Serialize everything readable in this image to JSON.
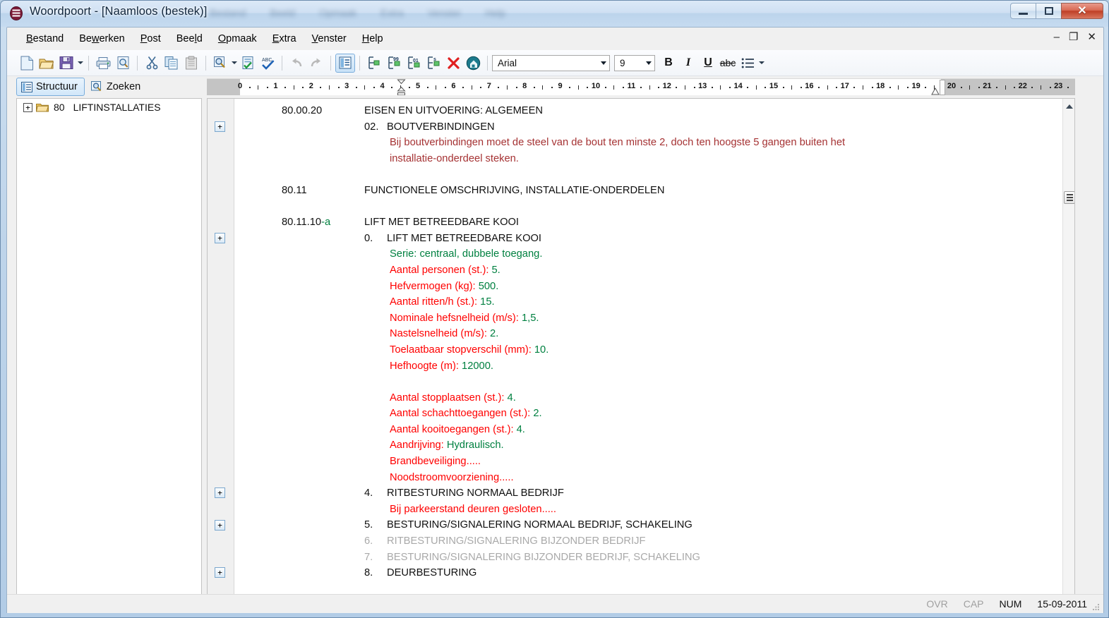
{
  "window": {
    "title": "Woordpoort - [Naamloos (bestek)]",
    "app_icon": "app-icon",
    "ghost_menu_items": [
      "Bestand",
      "Beeld",
      "Opmaak",
      "Extra",
      "Venster",
      "Help"
    ],
    "controls": {
      "minimize": "–",
      "restore": "□",
      "close": "✕"
    }
  },
  "menu": {
    "items": [
      {
        "label": "Bestand",
        "accel": "B"
      },
      {
        "label": "Bewerken",
        "accel": "w"
      },
      {
        "label": "Post",
        "accel": "P"
      },
      {
        "label": "Beeld",
        "accel": "l"
      },
      {
        "label": "Opmaak",
        "accel": "O"
      },
      {
        "label": "Extra",
        "accel": "E"
      },
      {
        "label": "Venster",
        "accel": "V"
      },
      {
        "label": "Help",
        "accel": "H"
      }
    ]
  },
  "mdi_controls": {
    "minimize": "–",
    "restore": "❐",
    "close": "✕"
  },
  "toolbar": {
    "buttons": [
      "new-document-icon",
      "open-folder-icon",
      "save-icon",
      "save-dropdown-arrow",
      "print-icon",
      "print-preview-icon",
      "cut-icon",
      "copy-icon",
      "paste-icon",
      "find-icon",
      "find-dropdown-arrow",
      "spellcheck-list-icon",
      "spelling-icon",
      "undo-icon",
      "redo-icon",
      "outline-view-icon",
      "insert-item-icon",
      "insert-numbered-item-icon",
      "insert-dot-item-icon",
      "insert-s-item-icon",
      "delete-icon",
      "export-icon"
    ],
    "font_name": "Arial",
    "font_size": "9",
    "bold_label": "B",
    "italic_label": "I",
    "underline_label": "U",
    "strike_label": "abc",
    "list_label": "list-icon",
    "list_dropdown_arrow": "chevron-down-icon"
  },
  "tabs": [
    {
      "label": "Structuur",
      "icon": "structure-icon",
      "selected": true
    },
    {
      "label": "Zoeken",
      "icon": "search-icon",
      "selected": false
    }
  ],
  "ruler": {
    "numbers": [
      0,
      1,
      2,
      3,
      4,
      5,
      6,
      7,
      8,
      9,
      10,
      11,
      12,
      13,
      14,
      15,
      16,
      17,
      18,
      19,
      20,
      21,
      22,
      23
    ],
    "left_margin_end": 0,
    "right_margin_start": 20,
    "first_line_indent": 4.5,
    "right_indent": 19.6,
    "unit": "cm"
  },
  "tree": {
    "rows": [
      {
        "expander": "+",
        "icon": "folder-icon",
        "code": "80",
        "label": "LIFTINSTALLATIES"
      }
    ]
  },
  "document": {
    "lines": [
      {
        "code": "80.00.20",
        "title": "EISEN EN UITVOERING: ALGEMEEN",
        "style": "black",
        "kind": "code-title"
      },
      {
        "num": "02.",
        "title": "BOUTVERBINDINGEN",
        "style": "black",
        "kind": "num-title",
        "plus": true
      },
      {
        "body": "Bij boutverbindingen moet de steel van de bout ten minste 2, doch ten hoogste 5 gangen buiten het",
        "style": "darkred",
        "kind": "body"
      },
      {
        "body": "installatie-onderdeel steken.",
        "style": "darkred",
        "kind": "body"
      },
      {
        "kind": "blank"
      },
      {
        "code": "80.11",
        "title": "FUNCTIONELE OMSCHRIJVING, INSTALLATIE-ONDERDELEN",
        "style": "black",
        "kind": "code-title"
      },
      {
        "kind": "blank"
      },
      {
        "code": "80.11.10",
        "code_suffix": "-a",
        "title": "LIFT MET BETREEDBARE KOOI",
        "style": "black",
        "kind": "code-title"
      },
      {
        "num": "0.",
        "title": "LIFT MET BETREEDBARE KOOI",
        "style": "black",
        "kind": "num-title",
        "plus": true
      },
      {
        "label": "Serie:",
        "value": " centraal, dubbele toegang.",
        "label_style": "green",
        "value_style": "green",
        "kind": "kv"
      },
      {
        "label": "Aantal personen (st.):",
        "value": " 5.",
        "label_style": "red",
        "value_style": "green",
        "kind": "kv"
      },
      {
        "label": "Hefvermogen (kg):",
        "value": " 500.",
        "label_style": "red",
        "value_style": "green",
        "kind": "kv"
      },
      {
        "label": "Aantal ritten/h (st.):",
        "value": " 15.",
        "label_style": "red",
        "value_style": "green",
        "kind": "kv"
      },
      {
        "label": "Nominale hefsnelheid (m/s):",
        "value": " 1,5.",
        "label_style": "red",
        "value_style": "green",
        "kind": "kv"
      },
      {
        "label": "Nastelsnelheid (m/s):",
        "value": " 2.",
        "label_style": "red",
        "value_style": "green",
        "kind": "kv"
      },
      {
        "label": "Toelaatbaar stopverschil (mm):",
        "value": " 10.",
        "label_style": "red",
        "value_style": "green",
        "kind": "kv"
      },
      {
        "label": "Hefhoogte (m):",
        "value": " 12000.",
        "label_style": "red",
        "value_style": "green",
        "kind": "kv"
      },
      {
        "kind": "blank"
      },
      {
        "label": "Aantal stopplaatsen (st.):",
        "value": " 4.",
        "label_style": "red",
        "value_style": "green",
        "kind": "kv"
      },
      {
        "label": "Aantal schachttoegangen (st.):",
        "value": " 2.",
        "label_style": "red",
        "value_style": "green",
        "kind": "kv"
      },
      {
        "label": "Aantal kooitoegangen (st.):",
        "value": " 4.",
        "label_style": "red",
        "value_style": "green",
        "kind": "kv"
      },
      {
        "label": "Aandrijving:",
        "value": " Hydraulisch.",
        "label_style": "red",
        "value_style": "green",
        "kind": "kv"
      },
      {
        "label": "Brandbeveiliging",
        "value": ".....",
        "label_style": "red",
        "value_style": "red",
        "kind": "kv"
      },
      {
        "label": "Noodstroomvoorziening",
        "value": ".....",
        "label_style": "red",
        "value_style": "red",
        "kind": "kv"
      },
      {
        "num": "4.",
        "title": "RITBESTURING NORMAAL BEDRIJF",
        "style": "black",
        "kind": "num-title",
        "plus": true
      },
      {
        "label": "Bij parkeerstand deuren gesloten",
        "value": ".....",
        "label_style": "red",
        "value_style": "red",
        "kind": "kv"
      },
      {
        "num": "5.",
        "title": "BESTURING/SIGNALERING NORMAAL BEDRIJF, SCHAKELING",
        "style": "black",
        "kind": "num-title",
        "plus": true
      },
      {
        "num": "6.",
        "title": "RITBESTURING/SIGNALERING BIJZONDER BEDRIJF",
        "style": "gray",
        "kind": "num-title"
      },
      {
        "num": "7.",
        "title": "BESTURING/SIGNALERING BIJZONDER BEDRIJF, SCHAKELING",
        "style": "gray",
        "kind": "num-title"
      },
      {
        "num": "8.",
        "title": "DEURBESTURING",
        "style": "black",
        "kind": "num-title",
        "plus": true
      }
    ]
  },
  "status_bar": {
    "overwrite": {
      "label": "OVR",
      "active": false
    },
    "caps": {
      "label": "CAP",
      "active": false
    },
    "num": {
      "label": "NUM",
      "active": true
    },
    "date": {
      "label": "15-09-2011",
      "active": true
    }
  },
  "colors": {
    "red": "#ff0000",
    "green": "#008040",
    "dark_red": "#a53233",
    "gray_disabled": "#a9a9a9",
    "accent_blue": "#7aaddc",
    "close_red": "#bf3f26"
  }
}
